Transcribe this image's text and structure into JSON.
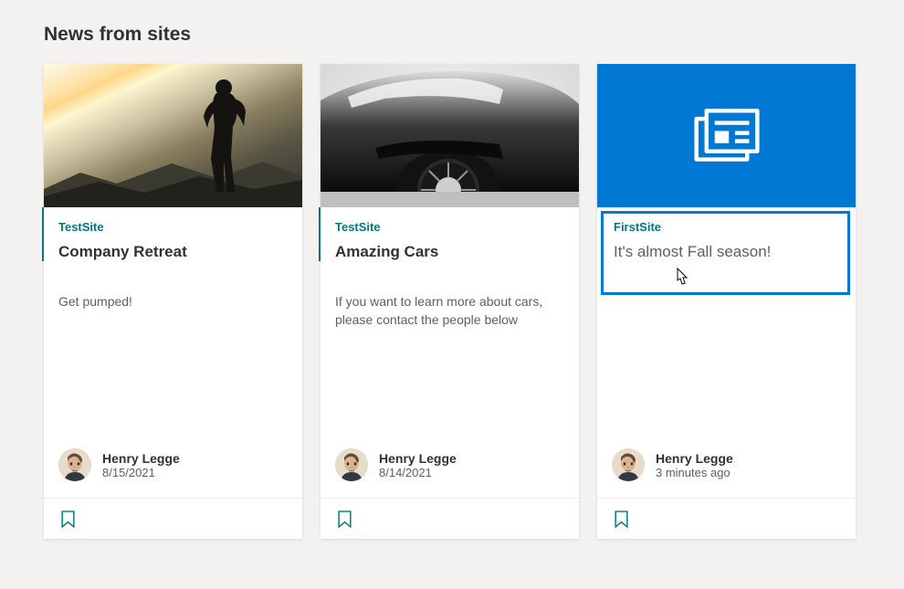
{
  "section_title": "News from sites",
  "accent_color": "#03787c",
  "brand_blue": "#0078d4",
  "cards": [
    {
      "site": "TestSite",
      "title": "Company Retreat",
      "description": "Get pumped!",
      "author": "Henry Legge",
      "date": "8/15/2021",
      "thumb_kind": "hiker",
      "highlighted": false
    },
    {
      "site": "TestSite",
      "title": "Amazing Cars",
      "description": "If you want to learn more about cars, please contact the people below",
      "author": "Henry Legge",
      "date": "8/14/2021",
      "thumb_kind": "car",
      "highlighted": false
    },
    {
      "site": "FirstSite",
      "title": "It's almost Fall season!",
      "description": "",
      "author": "Henry Legge",
      "date": "3 minutes ago",
      "thumb_kind": "placeholder",
      "icon": "news-icon",
      "highlighted": true
    }
  ]
}
